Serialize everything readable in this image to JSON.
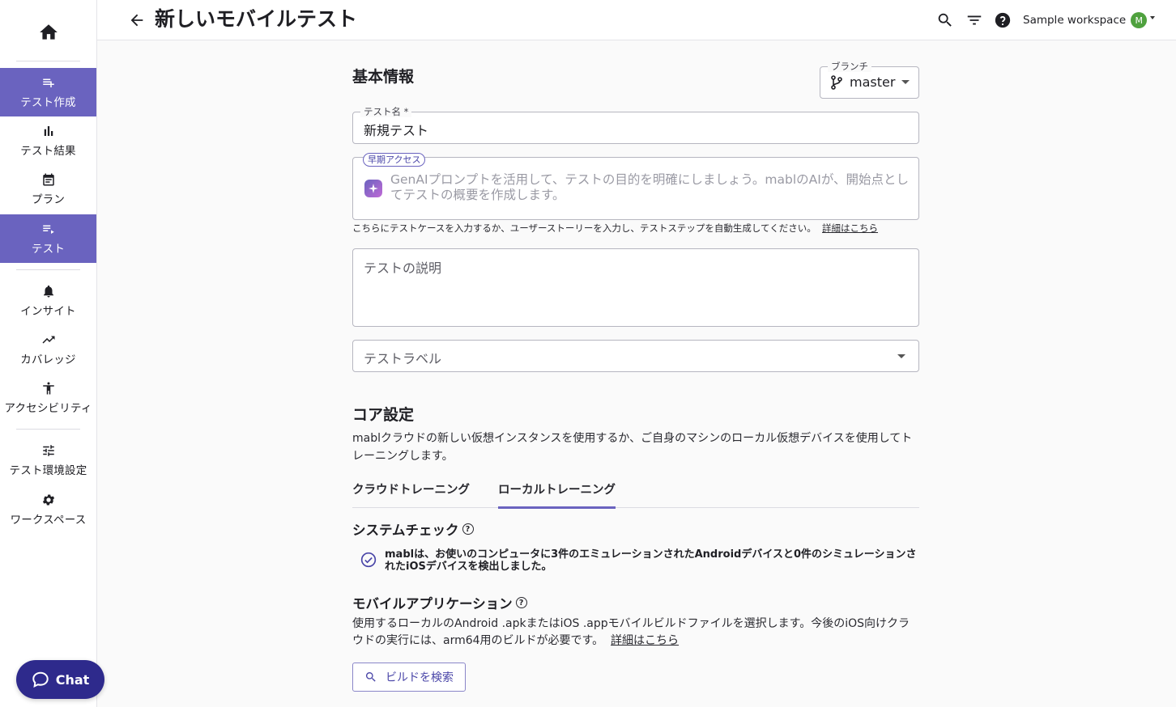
{
  "header": {
    "title": "新しいモバイルテスト",
    "workspace": "Sample workspace",
    "avatar_initial": "M"
  },
  "sidebar": {
    "items": [
      {
        "label": "テスト作成",
        "icon": "playlist-add-icon",
        "active": true
      },
      {
        "label": "テスト結果",
        "icon": "bar-chart-icon",
        "active": false
      },
      {
        "label": "プラン",
        "icon": "calendar-icon",
        "active": false
      },
      {
        "label": "テスト",
        "icon": "playlist-play-icon",
        "active": true
      },
      {
        "label": "インサイト",
        "icon": "bell-icon",
        "active": false
      },
      {
        "label": "カバレッジ",
        "icon": "trending-up-icon",
        "active": false
      },
      {
        "label": "アクセシビリティ",
        "icon": "accessibility-icon",
        "active": false
      },
      {
        "label": "テスト環境設定",
        "icon": "tune-icon",
        "active": false
      },
      {
        "label": "ワークスペース",
        "icon": "gear-icon",
        "active": false
      }
    ],
    "chat_label": "Chat"
  },
  "form": {
    "section_basic": "基本情報",
    "branch_label": "ブランチ",
    "branch_value": "master",
    "test_name_label": "テスト名 *",
    "test_name_value": "新規テスト",
    "early_access_badge": "早期アクセス",
    "genai_placeholder": "GenAIプロンプトを活用して、テストの目的を明確にしましょう。mablのAIが、開始点としてテストの概要を作成します。",
    "helper_text": "こちらにテストケースを入力するか、ユーザーストーリーを入力し、テストステップを自動生成してください。",
    "helper_link": "詳細はこちら",
    "description_placeholder": "テストの説明",
    "labels_placeholder": "テストラベル"
  },
  "core": {
    "title": "コア設定",
    "description": "mablクラウドの新しい仮想インスタンスを使用するか、ご自身のマシンのローカル仮想デバイスを使用してトレーニングします。",
    "tabs": [
      {
        "label": "クラウドトレーニング",
        "active": false
      },
      {
        "label": "ローカルトレーニング",
        "active": true
      }
    ],
    "system_check_title": "システムチェック",
    "system_check_result": "mablは、お使いのコンピュータに3件のエミュレーションされたAndroidデバイスと0件のシミュレーションされたiOSデバイスを検出しました。",
    "mobile_app_title": "モバイルアプリケーション",
    "mobile_app_desc": "使用するローカルのAndroid .apkまたはiOS .appモバイルビルドファイルを選択します。今後のiOS向けクラウドの実行には、arm64用のビルドが必要です。",
    "mobile_app_link": "詳細はこちら",
    "search_build_label": "ビルドを検索"
  },
  "colors": {
    "accent": "#6a63bf",
    "chat": "#2e2a8c",
    "avatar": "#4fa13e"
  }
}
